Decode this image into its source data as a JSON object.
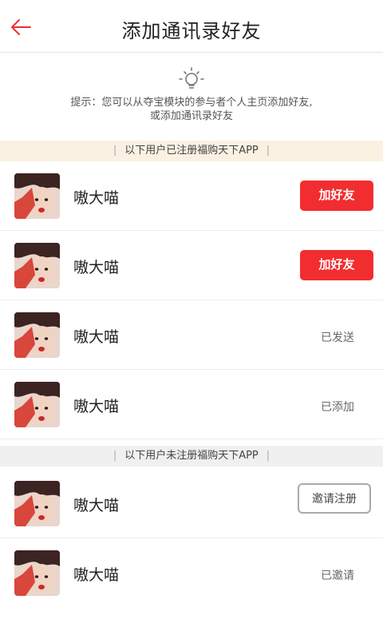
{
  "header": {
    "title": "添加通讯录好友"
  },
  "tip": {
    "line1": "提示：您可以从夺宝模块的参与者个人主页添加好友,",
    "line2": "或添加通讯录好友"
  },
  "registered": {
    "label": "以下用户已注册福购天下APP",
    "rows": [
      {
        "name": "嗷大喵",
        "action": "加好友"
      },
      {
        "name": "嗷大喵",
        "action": "加好友"
      },
      {
        "name": "嗷大喵",
        "status": "已发送"
      },
      {
        "name": "嗷大喵",
        "status": "已添加"
      }
    ]
  },
  "unregistered": {
    "label": "以下用户未注册福购天下APP",
    "rows": [
      {
        "name": "嗷大喵",
        "action": "邀请注册"
      },
      {
        "name": "嗷大喵",
        "status": "已邀请"
      }
    ]
  },
  "colors": {
    "accent_red": "#f22d2f",
    "registered_bar": "#fbf1e3",
    "unregistered_bar": "#f0f0f0"
  }
}
